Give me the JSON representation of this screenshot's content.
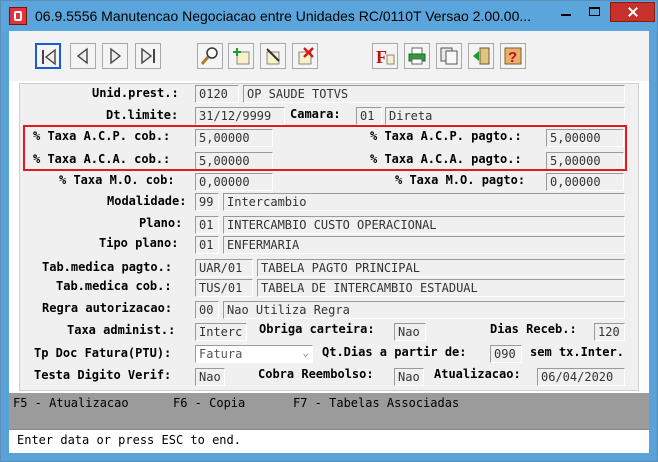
{
  "window": {
    "title": "06.9.5556 Manutencao  Negociacao entre Unidades RC/0110T Versao 2.00.00..."
  },
  "toolbar": {
    "buttons": [
      {
        "name": "first-record"
      },
      {
        "name": "previous-record"
      },
      {
        "name": "next-record"
      },
      {
        "name": "last-record"
      },
      {
        "name": "search"
      },
      {
        "name": "add"
      },
      {
        "name": "edit"
      },
      {
        "name": "delete"
      },
      {
        "name": "filter"
      },
      {
        "name": "print"
      },
      {
        "name": "copy"
      },
      {
        "name": "exit"
      },
      {
        "name": "help"
      }
    ]
  },
  "form": {
    "unid_prest": {
      "label": "Unid.prest.:",
      "code": "0120",
      "name": "OP SAUDE TOTVS"
    },
    "dt_limite": {
      "label": "Dt.limite:",
      "value": "31/12/9999"
    },
    "camara": {
      "label": "Camara:",
      "code": "01",
      "name": "Direta"
    },
    "taxa_acp_cob": {
      "label": "% Taxa A.C.P. cob.:",
      "value": "5,00000"
    },
    "taxa_acp_pagto": {
      "label": "% Taxa A.C.P. pagto.:",
      "value": "5,00000"
    },
    "taxa_aca_cob": {
      "label": "% Taxa A.C.A. cob.:",
      "value": "5,00000"
    },
    "taxa_aca_pagto": {
      "label": "% Taxa A.C.A. pagto.:",
      "value": "5,00000"
    },
    "taxa_mo_cob": {
      "label": "% Taxa M.O. cob:",
      "value": "0,00000"
    },
    "taxa_mo_pagto": {
      "label": "% Taxa M.O. pagto:",
      "value": "0,00000"
    },
    "modalidade": {
      "label": "Modalidade:",
      "code": "99",
      "name": "Intercambio"
    },
    "plano": {
      "label": "Plano:",
      "code": "01",
      "name": "INTERCAMBIO CUSTO OPERACIONAL"
    },
    "tipo_plano": {
      "label": "Tipo plano:",
      "code": "01",
      "name": "ENFERMARIA"
    },
    "tab_med_pagto": {
      "label": "Tab.medica pagto.:",
      "code": "UAR/01",
      "name": "TABELA PAGTO PRINCIPAL"
    },
    "tab_med_cob": {
      "label": "Tab.medica cob.:",
      "code": "TUS/01",
      "name": "TABELA DE INTERCAMBIO ESTADUAL"
    },
    "regra_autorizacao": {
      "label": "Regra autorizacao:",
      "code": "00",
      "name": "Nao Utiliza Regra"
    },
    "taxa_administ": {
      "label": "Taxa administ.:",
      "value": "Interc"
    },
    "obriga_carteira": {
      "label": "Obriga carteira:",
      "value": "Nao"
    },
    "dias_receb": {
      "label": "Dias Receb.:",
      "value": "120"
    },
    "tp_doc_fatura": {
      "label": "Tp Doc Fatura(PTU):",
      "value": "Fatura"
    },
    "qt_dias": {
      "label": "Qt.Dias a partir de:",
      "value": "090",
      "suffix": "sem tx.Inter."
    },
    "testa_digito": {
      "label": "Testa Digito Verif:",
      "value": "Nao"
    },
    "cobra_reembolso": {
      "label": "Cobra Reembolso:",
      "value": "Nao"
    },
    "atualizacao": {
      "label": "Atualizacao:",
      "value": "06/04/2020"
    }
  },
  "fkeys": {
    "f5": "F5 - Atualizacao",
    "f6": "F6 - Copia",
    "f7": "F7 - Tabelas Associadas"
  },
  "status": {
    "message": "Enter data or press ESC to end."
  }
}
